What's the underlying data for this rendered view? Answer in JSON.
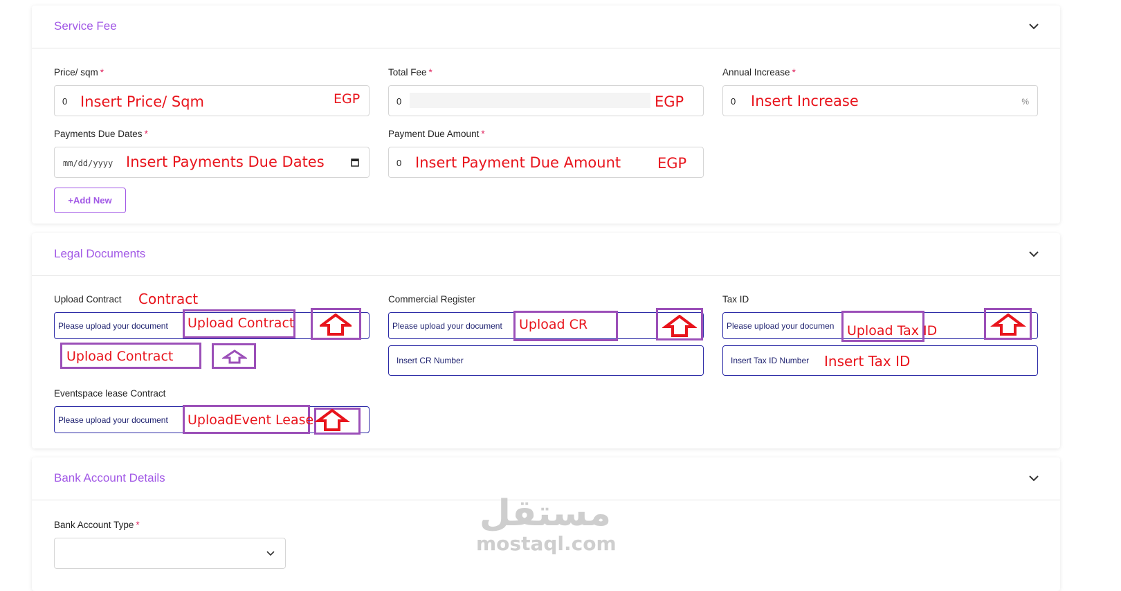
{
  "service_fee": {
    "title": "Service Fee",
    "price_label": "Price/ sqm",
    "price_value": "0",
    "price_hint": "Insert Price/ Sqm",
    "price_currency": "EGP",
    "total_label": "Total Fee",
    "total_value": "0",
    "total_currency": "EGP",
    "annual_label": "Annual Increase",
    "annual_value": "0",
    "annual_hint": "Insert Increase",
    "annual_suffix": "%",
    "due_dates_label": "Payments Due Dates",
    "due_dates_placeholder": "mm/dd/yyyy",
    "due_dates_hint": "Insert Payments Due Dates",
    "due_amount_label": "Payment Due Amount",
    "due_amount_value": "0",
    "due_amount_hint": "Insert Payment Due Amount",
    "due_amount_currency": "EGP",
    "add_new": "+Add New",
    "required_mark": "*"
  },
  "legal_documents": {
    "title": "Legal Documents",
    "contract_label": "Upload Contract",
    "contract_note": "Contract",
    "upload_placeholder": "Please upload your document",
    "contract_box": "Upload Contract",
    "contract_box2": "Upload Contract",
    "cr_label": "Commercial Register",
    "cr_box": "Upload CR",
    "cr_number_placeholder": "Insert CR Number",
    "tax_label": "Tax ID",
    "tax_upload_placeholder": "Please upload your documen",
    "tax_box": "Upload Tax ID",
    "tax_number_placeholder": "Insert Tax ID Number",
    "tax_number_hint": "Insert Tax ID",
    "event_label": "Eventspace lease Contract",
    "event_box": "UploadEvent Lease"
  },
  "bank_account": {
    "title": "Bank Account Details",
    "type_label": "Bank Account Type"
  },
  "watermark": {
    "arabic": "مستقل",
    "latin": "mostaql.com"
  },
  "colors": {
    "accent": "#a259e6",
    "annotation_red": "#e8141c",
    "annotation_box": "#9b4fb8",
    "upload_border": "#2b2aa6"
  }
}
